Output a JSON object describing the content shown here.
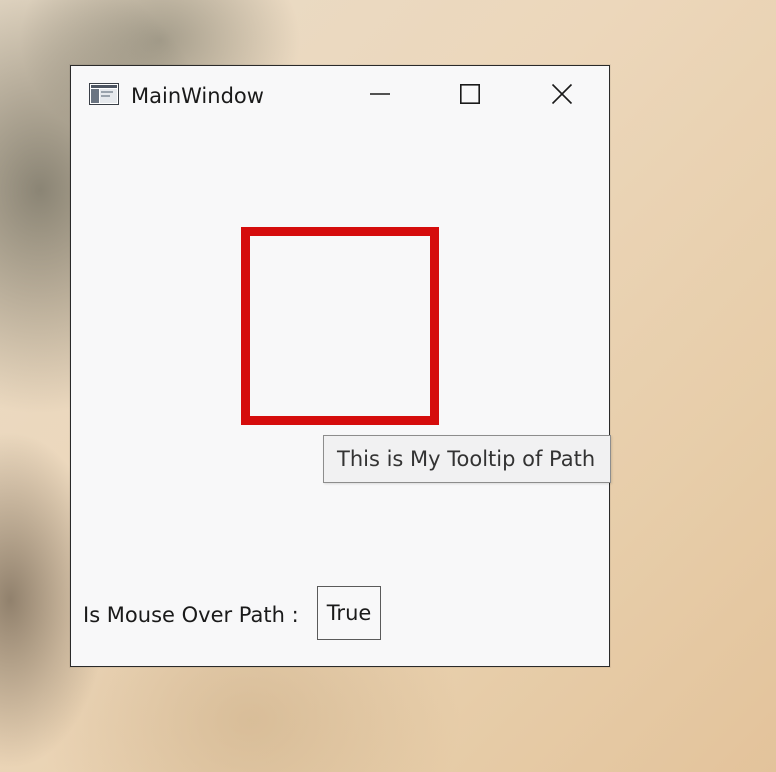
{
  "window": {
    "title": "MainWindow",
    "controls": {
      "minimize_icon": "minimize-icon",
      "maximize_icon": "maximize-icon",
      "close_icon": "close-icon"
    }
  },
  "canvas": {
    "path_stroke_color": "#d50c0c",
    "tooltip_text": "This is My Tooltip of Path",
    "mouse_over_label": "Is Mouse Over Path :",
    "mouse_over_value": "True"
  }
}
